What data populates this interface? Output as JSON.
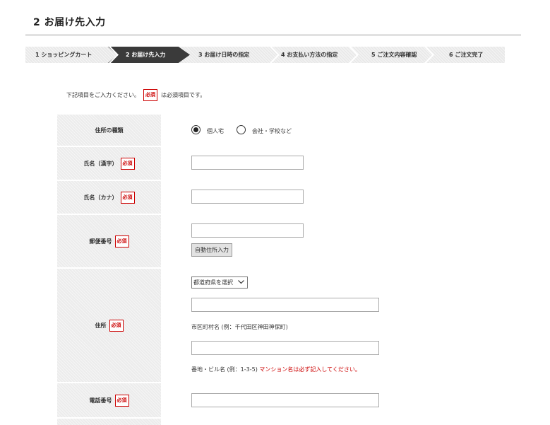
{
  "header": {
    "title": "2 お届け先入力"
  },
  "steps": [
    {
      "label": "1 ショッピングカート"
    },
    {
      "label": "2 お届け先入力"
    },
    {
      "label": "3 お届け日時の指定"
    },
    {
      "label": "4 お支払い方法の指定"
    },
    {
      "label": "5 ご注文内容確認"
    },
    {
      "label": "6 ご注文完了"
    }
  ],
  "intro": {
    "before": "下記項目をご入力ください。",
    "badge": "必須",
    "after": "は必須項目です。"
  },
  "form": {
    "required_badge": "必須",
    "address_type": {
      "label": "住所の種類",
      "options": [
        {
          "label": "個人宅",
          "checked": true
        },
        {
          "label": "会社・学校など",
          "checked": false
        }
      ]
    },
    "name_kanji": {
      "label": "氏名（漢字）",
      "value": ""
    },
    "name_kana": {
      "label": "氏名（カナ）",
      "value": ""
    },
    "postal_code": {
      "label": "郵便番号",
      "value": "",
      "button": "自動住所入力"
    },
    "address": {
      "label": "住所",
      "prefecture_select": "都道府県を選択",
      "city_value": "",
      "city_hint": "市区町村名 (例：千代田区神田神保町)",
      "street_value": "",
      "street_hint": "番地・ビル名 (例：1-3-5)",
      "street_warning": "マンション名は必ず記入してください。"
    },
    "phone": {
      "label": "電話番号",
      "value": ""
    }
  }
}
